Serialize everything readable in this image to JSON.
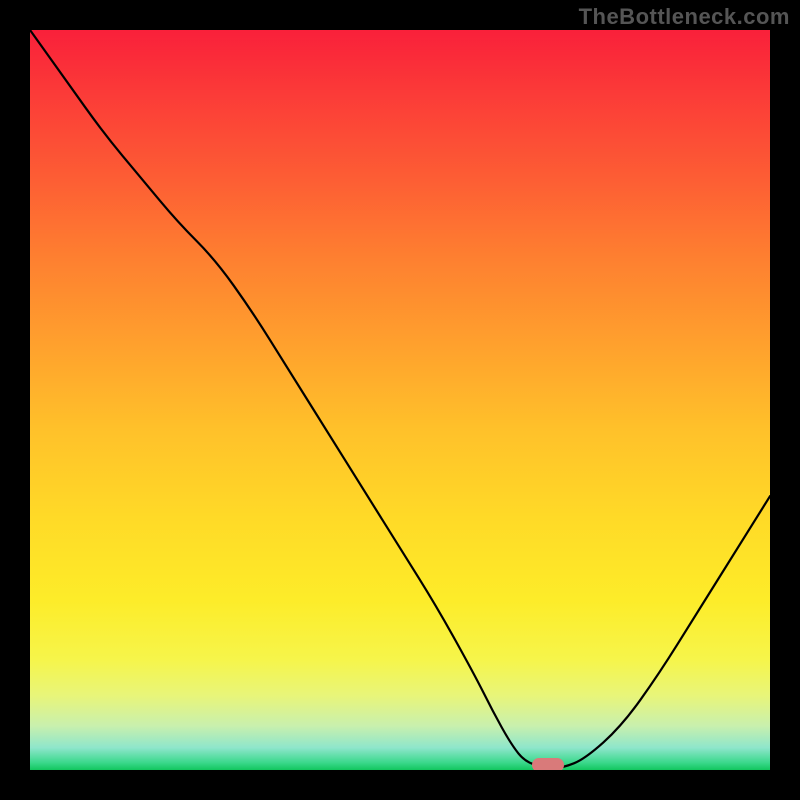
{
  "watermark": "TheBottleneck.com",
  "colors": {
    "frame": "#000000",
    "watermark_text": "#555555",
    "curve": "#000000",
    "marker": "#d97a7a",
    "gradient_top": "#f9203a",
    "gradient_bottom": "#12c65e"
  },
  "chart_data": {
    "type": "line",
    "title": "",
    "xlabel": "",
    "ylabel": "",
    "xlim": [
      0,
      100
    ],
    "ylim": [
      0,
      100
    ],
    "grid": false,
    "legend": false,
    "series": [
      {
        "name": "curve",
        "x": [
          0,
          5,
          10,
          15,
          20,
          25,
          30,
          35,
          40,
          45,
          50,
          55,
          60,
          62.5,
          65,
          67,
          70,
          72,
          75,
          80,
          85,
          90,
          95,
          100
        ],
        "y": [
          100,
          93,
          86,
          80,
          74,
          69,
          62,
          54,
          46,
          38,
          30,
          22,
          13,
          8,
          3.5,
          1,
          0.3,
          0.3,
          1.5,
          6,
          13,
          21,
          29,
          37
        ]
      }
    ],
    "marker": {
      "x": 70,
      "y": 0.7
    },
    "note": "y=0 is the bottom green edge; y=100 is the top red edge. Values estimated from pixel positions."
  }
}
